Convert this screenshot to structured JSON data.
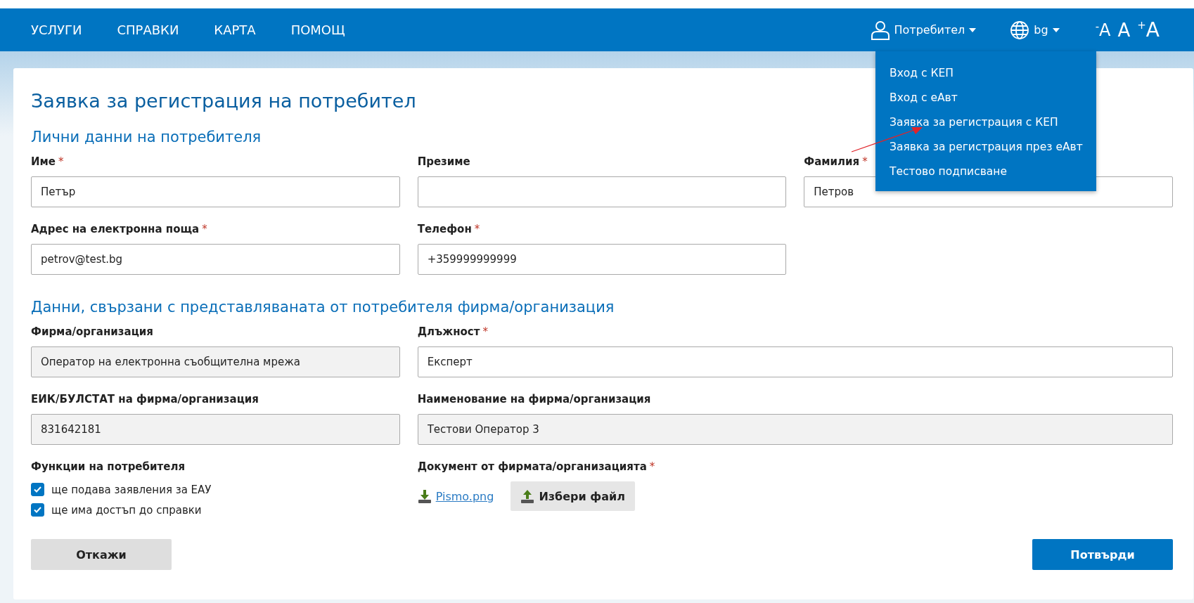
{
  "nav": {
    "items": [
      "УСЛУГИ",
      "СПРАВКИ",
      "КАРТА",
      "ПОМОЩ"
    ],
    "user_menu": {
      "label": "Потребител",
      "expanded": true,
      "items": [
        "Вход с КЕП",
        "Вход с еАвт",
        "Заявка за регистрация с КЕП",
        "Заявка за регистрация през еАвт",
        "Тестово подписване"
      ]
    },
    "language": {
      "label": "bg"
    },
    "font_controls": [
      {
        "kind": "decrease",
        "sign": "-",
        "label": "A"
      },
      {
        "kind": "normal",
        "label": "A"
      },
      {
        "kind": "increase",
        "sign": "+",
        "label": "A"
      }
    ]
  },
  "annotation": {
    "kind": "arrow"
  },
  "title": "Заявка за регистрация на потребител",
  "required_mark": "*",
  "sections": [
    {
      "kind": "personal",
      "title": "Лични данни на потребителя",
      "rows": [
        [
          {
            "label": "Име",
            "required": true,
            "value": "Петър",
            "disabled": false
          },
          {
            "label": "Презиме",
            "required": false,
            "disabled": false
          },
          {
            "label": "Фамилия",
            "required": true,
            "value": "Петров",
            "disabled": false
          }
        ],
        [
          {
            "label": "Адрес на електронна поща",
            "required": true,
            "value": "petrov@test.bg",
            "disabled": false
          },
          {
            "label": "Телефон",
            "required": true,
            "value": "+359999999999",
            "disabled": false
          }
        ]
      ]
    },
    {
      "kind": "organization",
      "title": "Данни, свързани с представляваната от потребителя фирма/организация",
      "rows": [
        [
          {
            "label": "Фирма/организация",
            "required": false,
            "value": "Оператор на електронна съобщителна мрежа",
            "disabled": true
          },
          {
            "label": "Длъжност",
            "required": true,
            "value": "Експерт",
            "disabled": false
          }
        ],
        [
          {
            "label": "ЕИК/БУЛСТАТ на фирма/организация",
            "required": false,
            "value": "831642181",
            "disabled": true
          },
          {
            "label": "Наименование на фирма/организация",
            "required": false,
            "value": "Тестови Оператор 3",
            "disabled": true
          }
        ]
      ]
    }
  ],
  "functions": {
    "label": "Функции на потребителя",
    "options": [
      {
        "label": "ще подава заявления за ЕАУ",
        "checked": true
      },
      {
        "label": "ще има достъп до справки",
        "checked": true
      }
    ]
  },
  "document": {
    "label": "Документ от фирмата/организацията",
    "required": true,
    "file": "Pismo.png",
    "upload_button": "Избери файл"
  },
  "buttons": {
    "cancel": "Откажи",
    "confirm": "Потвърди"
  }
}
